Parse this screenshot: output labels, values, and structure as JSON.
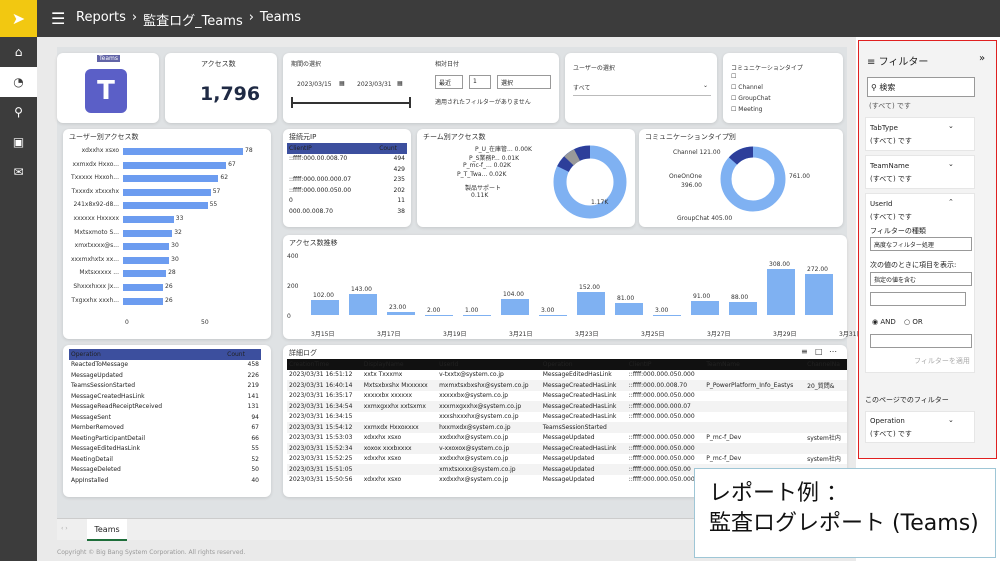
{
  "topbar": {
    "crumb1": "Reports",
    "crumb2": "監査ログ_Teams",
    "crumb3": "Teams"
  },
  "logo_text": "Teams",
  "access": {
    "label": "アクセス数",
    "value": "1,796"
  },
  "period": {
    "label": "期間の選択",
    "start": "2023/03/15",
    "end": "2023/03/31"
  },
  "relative": {
    "label": "相対日付",
    "unit": "最近",
    "num": "1",
    "choose": "選択",
    "note": "適用されたフィルターがありません"
  },
  "user_select": {
    "label": "ユーザーの選択",
    "value": "すべて"
  },
  "comm_type": {
    "label": "コミュニケーションタイプ",
    "options": [
      "",
      "Channel",
      "GroupChat",
      "Meeting"
    ]
  },
  "user_access": {
    "title": "ユーザー別アクセス数",
    "rows": [
      [
        "xdxxhx xsxo",
        "78"
      ],
      [
        "xxmxdx Hxxo...",
        "67"
      ],
      [
        "Txxxxx Hxxoh...",
        "62"
      ],
      [
        "Txxxdx xtxxxhx",
        "57"
      ],
      [
        "241x8x92-d8...",
        "55"
      ],
      [
        "xxxxxx Hxxxxx",
        "33"
      ],
      [
        "Mxtsxmoto S...",
        "32"
      ],
      [
        "xmxtxxxx@s...",
        "30"
      ],
      [
        "xxxmxhxtx xx...",
        "30"
      ],
      [
        "Mxtsxxxxx ...",
        "28"
      ],
      [
        "Shxxxhxxx Jx...",
        "26"
      ],
      [
        "Txgxxhx xxxh...",
        "26"
      ]
    ],
    "ticks": [
      "0",
      "50"
    ]
  },
  "client_ip": {
    "title": "接続元IP",
    "col1": "ClientIP",
    "col2": "Count",
    "rows": [
      [
        "::ffff:000.00.008.70",
        "494"
      ],
      [
        "",
        "429"
      ],
      [
        "::ffff:000.000.000.07",
        "235"
      ],
      [
        "::ffff:000.000.050.00",
        "202"
      ],
      [
        "0",
        "11"
      ],
      [
        "000.00.008.70",
        "38"
      ]
    ]
  },
  "team_access": {
    "title": "チーム別アクセス数",
    "labels": [
      "P_U_在庫管... 0.00K",
      "P_S業務P... 0.01K",
      "P_mc-f_... 0.02K",
      "P_T_Twa... 0.02K",
      "製品サポート",
      "0.11K"
    ],
    "big": "1.17K"
  },
  "comm_access": {
    "title": "コミュニケーションタイプ別",
    "channel": "Channel 121.00",
    "oneonone": "OneOnOne",
    "oneval": "396.00",
    "right": "761.00",
    "group": "GroupChat 405.00"
  },
  "trend": {
    "title": "アクセス数推移",
    "yticks": [
      "400",
      "200",
      "0"
    ],
    "values": [
      102,
      143,
      23,
      2,
      1,
      104,
      3,
      152,
      81,
      3,
      91,
      88,
      308,
      272
    ],
    "value_labels": [
      "102.00",
      "143.00",
      "23.00",
      "2.00",
      "1.00",
      "104.00",
      "3.00",
      "152.00",
      "81.00",
      "3.00",
      "91.00",
      "88.00",
      "308.00",
      "272.00"
    ],
    "xticks": [
      "3月15日",
      "3月17日",
      "3月19日",
      "3月21日",
      "3月23日",
      "3月25日",
      "3月27日",
      "3月29日",
      "3月31日"
    ]
  },
  "operation": {
    "col1": "Operation",
    "col2": "Count",
    "rows": [
      [
        "ReactedToMessage",
        "458"
      ],
      [
        "MessageUpdated",
        "226"
      ],
      [
        "TeamsSessionStarted",
        "219"
      ],
      [
        "MessageCreatedHasLink",
        "141"
      ],
      [
        "MessageReadReceiptReceived",
        "131"
      ],
      [
        "MessageSent",
        "94"
      ],
      [
        "MemberRemoved",
        "67"
      ],
      [
        "MeetingParticipantDetail",
        "66"
      ],
      [
        "MessageEditedHasLink",
        "55"
      ],
      [
        "MeetingDetail",
        "52"
      ],
      [
        "MessageDeleted",
        "50"
      ],
      [
        "AppInstalled",
        "40"
      ]
    ]
  },
  "detail": {
    "title": "詳細ログ",
    "headers": [
      "CreationTime",
      "DisplayName",
      "UserId",
      "Operation",
      "ClientIP",
      "TeamName",
      "ChannelNa"
    ],
    "rows": [
      [
        "2023/03/31 16:51:12",
        "xxtx Txxxmx",
        "v-txxtx@system.co.jp",
        "MessageEditedHasLink",
        "::ffff:000.000.050.000",
        "",
        ""
      ],
      [
        "2023/03/31 16:40:14",
        "Mxtsxbxshx Mxxxxxx",
        "mxmxtsxbxshx@system.co.jp",
        "MessageCreatedHasLink",
        "::ffff:000.00.008.70",
        "P_PowerPlatform_Info_Eastys",
        "20_質問&"
      ],
      [
        "2023/03/31 16:35:17",
        "xxxxxbx xxxxxx",
        "xxxxxbx@system.co.jp",
        "MessageCreatedHasLink",
        "::ffff:000.000.050.000",
        "",
        ""
      ],
      [
        "2023/03/31 16:34:54",
        "xxmxgxxhx xxtsxmx",
        "xxxmxgxxhx@system.co.jp",
        "MessageCreatedHasLink",
        "::ffff:000.000.000.07",
        "",
        ""
      ],
      [
        "2023/03/31 16:34:15",
        "",
        "xxxshxxxhx@system.co.jp",
        "MessageCreatedHasLink",
        "::ffff:000.000.050.000",
        "",
        ""
      ],
      [
        "2023/03/31 15:54:12",
        "xxmxdx Hxxoxxxx",
        "hxxmxdx@system.co.jp",
        "TeamsSessionStarted",
        "",
        "",
        ""
      ],
      [
        "2023/03/31 15:53:03",
        "xdxxhx xsxo",
        "xxdxxhx@system.co.jp",
        "MessageUpdated",
        "::ffff:000.000.050.000",
        "P_mc-f_Dev",
        "system社内"
      ],
      [
        "2023/03/31 15:52:34",
        "xoxox xxxbxxxx",
        "v-xxoxox@system.co.jp",
        "MessageCreatedHasLink",
        "::ffff:000.000.050.000",
        "",
        ""
      ],
      [
        "2023/03/31 15:52:25",
        "xdxxhx xsxo",
        "xxdxxhx@system.co.jp",
        "MessageUpdated",
        "::ffff:000.000.050.000",
        "P_mc-f_Dev",
        "system社内"
      ],
      [
        "2023/03/31 15:51:05",
        "",
        "xmxtsxxxx@system.co.jp",
        "MessageUpdated",
        "::ffff:000.000.050.00",
        "",
        ""
      ],
      [
        "2023/03/31 15:50:56",
        "xdxxhx xsxo",
        "xxdxxhx@system.co.jp",
        "MessageUpdated",
        "::ffff:000.000.050.000",
        "",
        ""
      ]
    ]
  },
  "filters": {
    "title": "フィルター",
    "search": "検索",
    "top_partial": "(すべて) です",
    "cards": [
      {
        "name": "TabType",
        "val": "(すべて) です"
      },
      {
        "name": "TeamName",
        "val": "(すべて) です"
      },
      {
        "name": "UserId",
        "val": "(すべて) です"
      }
    ],
    "kind_label": "フィルターの種類",
    "kind_value": "高度なフィルター処理",
    "show_label": "次の値のときに項目を表示:",
    "cond": "指定の値を含む",
    "and": "AND",
    "or": "OR",
    "apply": "フィルターを適用",
    "page_section": "このページでのフィルター",
    "op_name": "Operation",
    "op_val": "(すべて) です"
  },
  "tabs": {
    "teams": "Teams"
  },
  "copyright": "Copyright © Big Bang System Corporation. All rights reserved.",
  "callout": {
    "line1": "レポート例 ：",
    "line2": "監査ログレポート (Teams)"
  }
}
